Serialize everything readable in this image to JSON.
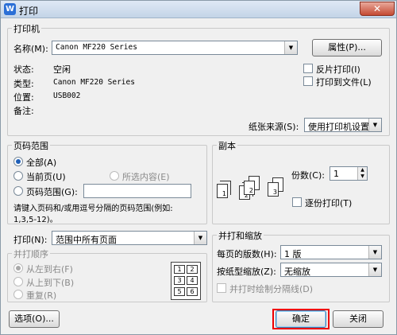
{
  "window": {
    "title": "打印",
    "app_icon": "W",
    "close_label": "✕"
  },
  "printer": {
    "group_label": "打印机",
    "name_label": "名称(M):",
    "name_value": "Canon MF220 Series",
    "properties_button": "属性(P)...",
    "status_label": "状态:",
    "status_value": "空闲",
    "type_label": "类型:",
    "type_value": "Canon MF220 Series",
    "location_label": "位置:",
    "location_value": "USB002",
    "comment_label": "备注:",
    "reverse_print": "反片打印(I)",
    "print_to_file": "打印到文件(L)",
    "paper_source_label": "纸张来源(S):",
    "paper_source_value": "使用打印机设置"
  },
  "page_range": {
    "group_label": "页码范围",
    "all": "全部(A)",
    "current": "当前页(U)",
    "selection": "所选内容(E)",
    "pages": "页码范围(G):",
    "pages_value": "",
    "hint_line1": "请键入页码和/或用逗号分隔的页码范围(例如:",
    "hint_line2": "1,3,5-12)。"
  },
  "copies": {
    "group_label": "副本",
    "count_label": "份数(C):",
    "count_value": "1",
    "collate": "逐份打印(T)",
    "page_numbers": [
      "1",
      "2",
      "3"
    ]
  },
  "print_what": {
    "label": "打印(N):",
    "value": "范围中所有页面"
  },
  "order": {
    "group_label": "并打顺序",
    "left_to_right": "从左到右(F)",
    "top_to_bottom": "从上到下(B)",
    "repeat": "重复(R)",
    "tiles": [
      "1",
      "2",
      "3",
      "4",
      "5",
      "6"
    ]
  },
  "zoom": {
    "group_label": "并打和缩放",
    "pages_per_sheet_label": "每页的版数(H):",
    "pages_per_sheet_value": "1 版",
    "scale_label": "按纸型缩放(Z):",
    "scale_value": "无缩放",
    "draw_borders": "并打时绘制分隔线(D)"
  },
  "footer": {
    "options_button": "选项(O)...",
    "ok_button": "确定",
    "close_button": "关闭"
  },
  "colors": {
    "accent": "#1f5fb8",
    "highlight": "#e00000"
  }
}
